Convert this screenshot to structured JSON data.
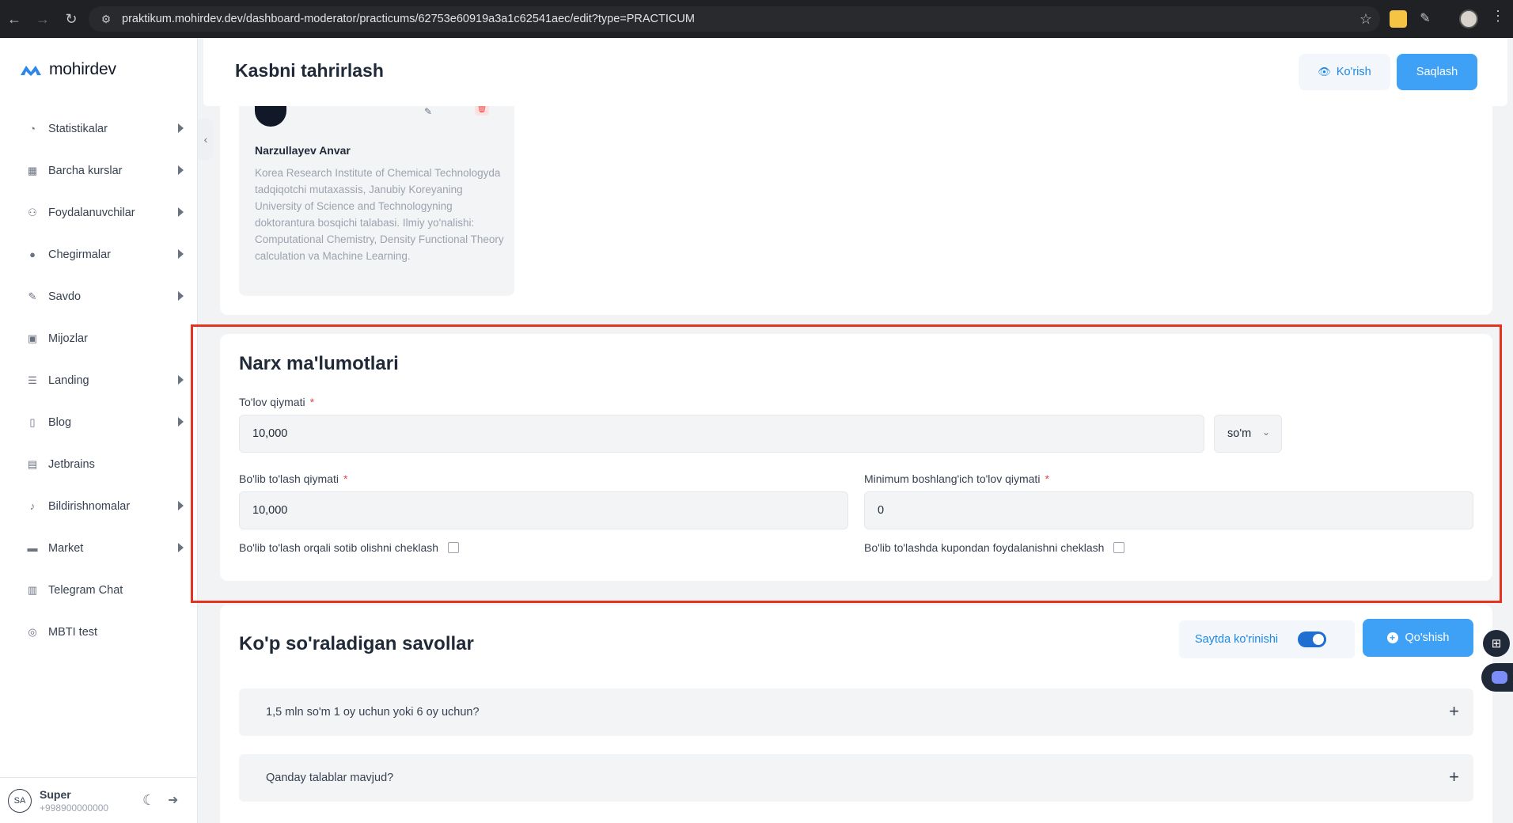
{
  "browser": {
    "url": "praktikum.mohirdev.dev/dashboard-moderator/practicums/62753e60919a3a1c62541aec/edit?type=PRACTICUM"
  },
  "sidebar": {
    "brand": "mohirdev",
    "items": [
      {
        "label": "Statistikalar",
        "icon": "pie-chart-icon",
        "has_submenu": true
      },
      {
        "label": "Barcha kurslar",
        "icon": "grid-icon",
        "has_submenu": true
      },
      {
        "label": "Foydalanuvchilar",
        "icon": "users-icon",
        "has_submenu": true
      },
      {
        "label": "Chegirmalar",
        "icon": "discount-icon",
        "has_submenu": true
      },
      {
        "label": "Savdo",
        "icon": "pen-icon",
        "has_submenu": true
      },
      {
        "label": "Mijozlar",
        "icon": "calendar-icon",
        "has_submenu": false
      },
      {
        "label": "Landing",
        "icon": "layers-icon",
        "has_submenu": true
      },
      {
        "label": "Blog",
        "icon": "document-icon",
        "has_submenu": true
      },
      {
        "label": "Jetbrains",
        "icon": "box-icon",
        "has_submenu": false
      },
      {
        "label": "Bildirishnomalar",
        "icon": "bell-icon",
        "has_submenu": true
      },
      {
        "label": "Market",
        "icon": "store-icon",
        "has_submenu": true
      },
      {
        "label": "Telegram Chat",
        "icon": "chat-icon",
        "has_submenu": false
      },
      {
        "label": "MBTI test",
        "icon": "brain-icon",
        "has_submenu": false
      }
    ],
    "user": {
      "initials": "SA",
      "name": "Super",
      "phone": "+998900000000"
    }
  },
  "header": {
    "title": "Kasbni tahrirlash",
    "view_label": "Ko'rish",
    "save_label": "Saqlash"
  },
  "instructor": {
    "name": "Narzullayev Anvar",
    "bio": "Korea Research Institute of Chemical Technologyda tadqiqotchi mutaxassis, Janubiy Koreyaning University of Science and Technologyning doktorantura bosqichi talabasi. Ilmiy yo'nalishi: Computational Chemistry, Density Functional Theory calculation va Machine Learning."
  },
  "price": {
    "section_title": "Narx ma'lumotlari",
    "payment_label": "To'lov qiymati",
    "payment_value": "10,000",
    "currency": "so'm",
    "installment_label": "Bo'lib to'lash qiymati",
    "installment_value": "10,000",
    "min_initial_label": "Minimum boshlang'ich to'lov qiymati",
    "min_initial_value": "0",
    "restrict_installment_label": "Bo'lib to'lash orqali sotib olishni cheklash",
    "restrict_coupon_label": "Bo'lib to'lashda kupondan foydalanishni cheklash",
    "required_mark": "*"
  },
  "faq": {
    "title": "Ko'p so'raladigan savollar",
    "visibility_label": "Saytda ko'rinishi",
    "visibility_on": true,
    "add_label": "Qo'shish",
    "items": [
      {
        "question": "1,5 mln so'm 1 oy uchun yoki 6 oy uchun?"
      },
      {
        "question": "Qanday talablar mavjud?"
      }
    ]
  },
  "colors": {
    "accent": "#3ea1f5",
    "highlight_border": "#e53320"
  }
}
